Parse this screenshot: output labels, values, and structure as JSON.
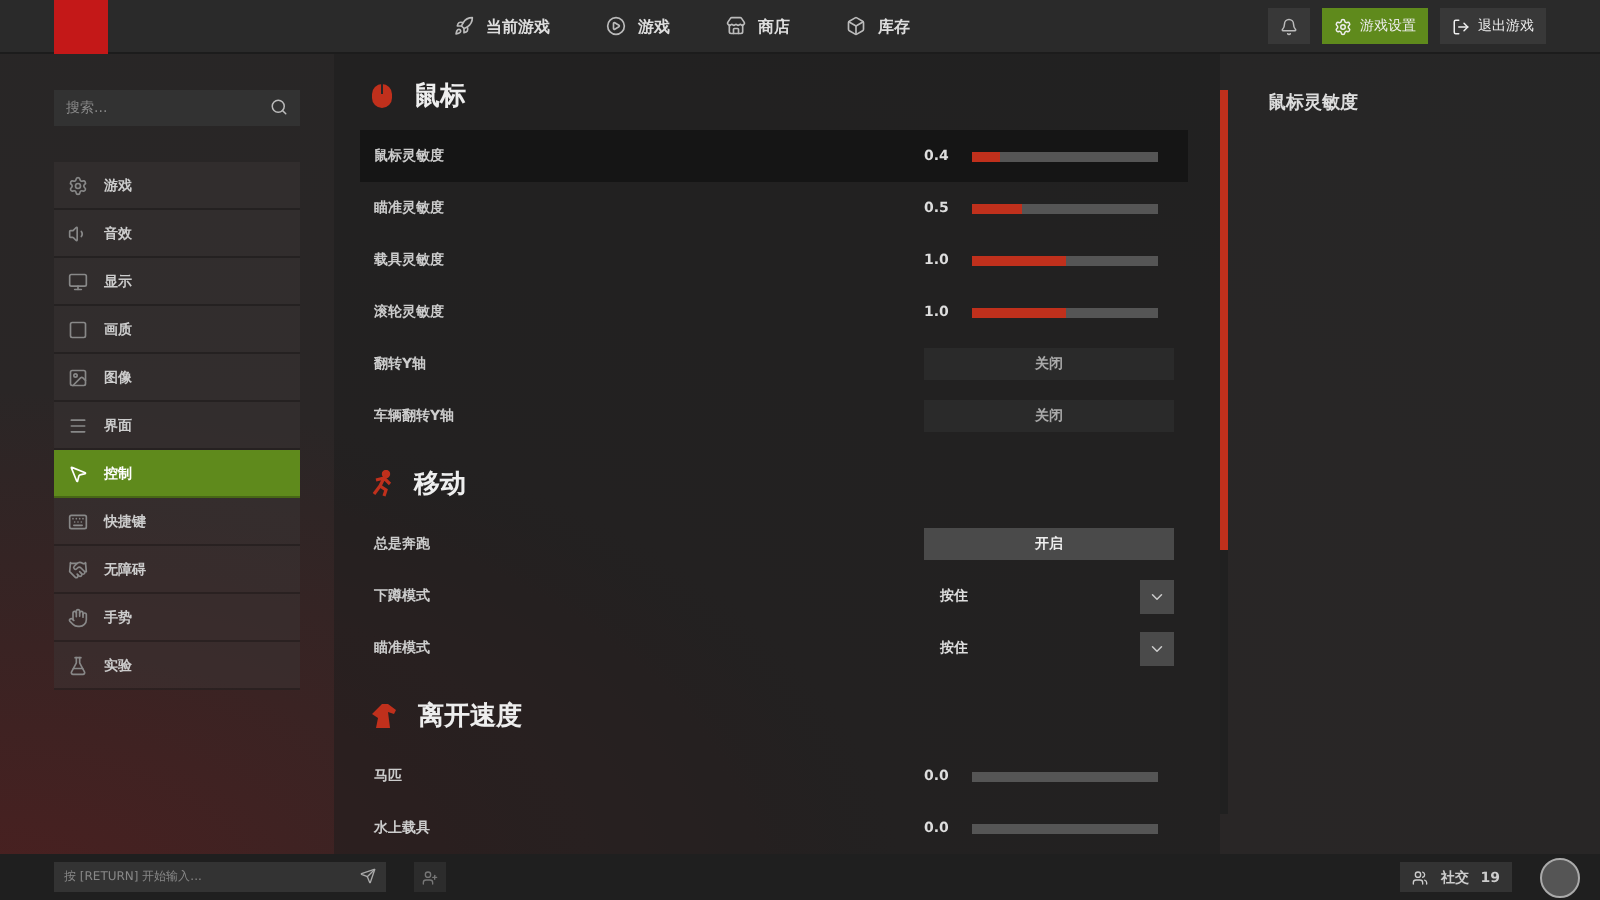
{
  "topbar": {
    "nav": [
      {
        "label": "当前游戏"
      },
      {
        "label": "游戏"
      },
      {
        "label": "商店"
      },
      {
        "label": "库存"
      }
    ],
    "settings_button": "游戏设置",
    "exit_button": "退出游戏"
  },
  "sidebar": {
    "search": {
      "placeholder": "搜索..."
    },
    "items": [
      {
        "label": "游戏",
        "selected": false
      },
      {
        "label": "音效",
        "selected": false
      },
      {
        "label": "显示",
        "selected": false
      },
      {
        "label": "画质",
        "selected": false
      },
      {
        "label": "图像",
        "selected": false
      },
      {
        "label": "界面",
        "selected": false
      },
      {
        "label": "控制",
        "selected": true
      },
      {
        "label": "快捷键",
        "selected": false
      },
      {
        "label": "无障碍",
        "selected": false
      },
      {
        "label": "手势",
        "selected": false
      },
      {
        "label": "实验",
        "selected": false
      }
    ]
  },
  "sections": [
    {
      "title": "鼠标",
      "rows": [
        {
          "kind": "slider",
          "label": "鼠标灵敏度",
          "reading": "0.4",
          "level": 0.15,
          "selected": true
        },
        {
          "kind": "slider",
          "label": "瞄准灵敏度",
          "reading": "0.5",
          "level": 0.27,
          "selected": false
        },
        {
          "kind": "slider",
          "label": "载具灵敏度",
          "reading": "1.0",
          "level": 0.5,
          "selected": false
        },
        {
          "kind": "slider",
          "label": "滚轮灵敏度",
          "reading": "1.0",
          "level": 0.5,
          "selected": false
        },
        {
          "kind": "toggle",
          "label": "翻转Y轴",
          "value": "关闭",
          "on": false,
          "selected": false
        },
        {
          "kind": "toggle",
          "label": "车辆翻转Y轴",
          "value": "关闭",
          "on": false,
          "selected": false
        }
      ]
    },
    {
      "title": "移动",
      "rows": [
        {
          "kind": "toggle",
          "label": "总是奔跑",
          "value": "开启",
          "on": true,
          "selected": false
        },
        {
          "kind": "dropdown",
          "label": "下蹲模式",
          "value": "按住",
          "selected": false
        },
        {
          "kind": "dropdown",
          "label": "瞄准模式",
          "value": "按住",
          "selected": false
        }
      ]
    },
    {
      "title": "离开速度",
      "rows": [
        {
          "kind": "slider",
          "label": "马匹",
          "reading": "0.0",
          "selected": false
        },
        {
          "kind": "slider",
          "label": "水上载具",
          "reading": "0.0",
          "selected": false
        }
      ]
    }
  ],
  "detail": {
    "title": "鼠标灵敏度"
  },
  "bottombar": {
    "chat": {
      "placeholder": "按 [RETURN] 开始输入..."
    },
    "social": {
      "label": "社交",
      "count": "19"
    }
  }
}
